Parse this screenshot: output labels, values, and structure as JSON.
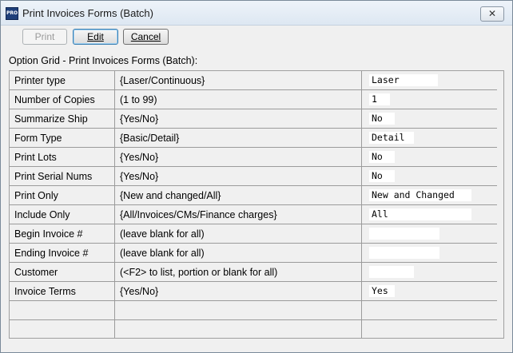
{
  "window": {
    "title": "Print Invoices Forms (Batch)",
    "app_icon_text": "PRO",
    "close_glyph": "✕"
  },
  "toolbar": {
    "print_label": "Print",
    "edit_label": "Edit",
    "cancel_label": "Cancel"
  },
  "grid": {
    "caption": "Option Grid - Print Invoices Forms (Batch):",
    "rows": [
      {
        "option": "Printer type",
        "choices": "{Laser/Continuous}",
        "value": "Laser"
      },
      {
        "option": "Number of Copies",
        "choices": "(1 to 99)",
        "value": "1"
      },
      {
        "option": "Summarize Ship",
        "choices": "{Yes/No}",
        "value": "No"
      },
      {
        "option": "Form Type",
        "choices": "{Basic/Detail}",
        "value": "Detail"
      },
      {
        "option": "Print Lots",
        "choices": "{Yes/No}",
        "value": "No"
      },
      {
        "option": "Print Serial Nums",
        "choices": "{Yes/No}",
        "value": "No"
      },
      {
        "option": "Print Only",
        "choices": "{New and changed/All}",
        "value": "New and Changed"
      },
      {
        "option": "Include Only",
        "choices": "{All/Invoices/CMs/Finance charges}",
        "value": "All"
      },
      {
        "option": "Begin Invoice #",
        "choices": "(leave blank for all)",
        "value": ""
      },
      {
        "option": "Ending Invoice #",
        "choices": "(leave blank for all)",
        "value": ""
      },
      {
        "option": "Customer",
        "choices": "(<F2> to list, portion or blank for all)",
        "value": ""
      },
      {
        "option": "Invoice Terms",
        "choices": "{Yes/No}",
        "value": "Yes"
      }
    ]
  }
}
